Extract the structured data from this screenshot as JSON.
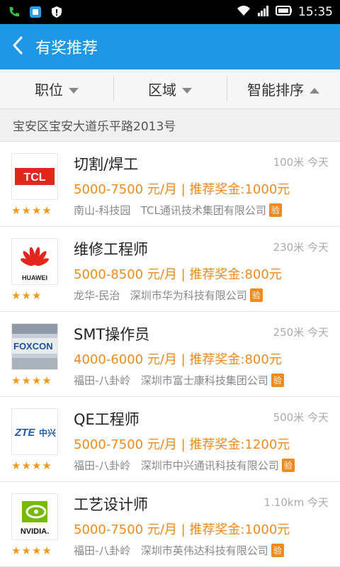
{
  "status": {
    "time": "15:35"
  },
  "header": {
    "title": "有奖推荐"
  },
  "filters": [
    {
      "label": "职位",
      "arrow": "down"
    },
    {
      "label": "区域",
      "arrow": "down"
    },
    {
      "label": "智能排序",
      "arrow": "up"
    }
  ],
  "address": "宝安区宝安大道乐平路2013号",
  "accent": "#1e98e6",
  "salary_color": "#f08a1c",
  "jobs": [
    {
      "title": "切割/焊工",
      "distance": "100米 今天",
      "salary": "5000-7500 元/月 | 推荐奖金:1000元",
      "area": "南山-科技园",
      "company": "TCL通讯技术集团有限公司",
      "verify": "验",
      "stars": "★★★★",
      "rating": 4,
      "logo": "tcl-logo"
    },
    {
      "title": "维修工程师",
      "distance": "230米 今天",
      "salary": "5000-8500 元/月 | 推荐奖金:800元",
      "area": "龙华-民治",
      "company": "深圳市华为科技有限公司",
      "verify": "验",
      "stars": "★★★",
      "rating": 3,
      "logo": "huawei-logo",
      "logo_text": "HUAWEI"
    },
    {
      "title": "SMT操作员",
      "distance": "250米 今天",
      "salary": "4000-6000 元/月 | 推荐奖金:800元",
      "area": "福田-八卦岭",
      "company": "深圳市富士康科技集团公司",
      "verify": "验",
      "stars": "★★★★",
      "rating": 4,
      "logo": "foxconn-logo"
    },
    {
      "title": "QE工程师",
      "distance": "500米 今天",
      "salary": "5000-7500 元/月 | 推荐奖金:1200元",
      "area": "福田-八卦岭",
      "company": "深圳市中兴通讯科技有限公司",
      "verify": "验",
      "stars": "★★★★",
      "rating": 4,
      "logo": "zte-logo"
    },
    {
      "title": "工艺设计师",
      "distance": "1.10km 今天",
      "salary": "5000-7500 元/月 | 推荐奖金:1000元",
      "area": "福田-八卦岭",
      "company": "深圳市英伟达科技有限公司",
      "verify": "验",
      "stars": "★★★★",
      "rating": 4,
      "logo": "nvidia-logo",
      "logo_text": "NVIDIA."
    }
  ]
}
